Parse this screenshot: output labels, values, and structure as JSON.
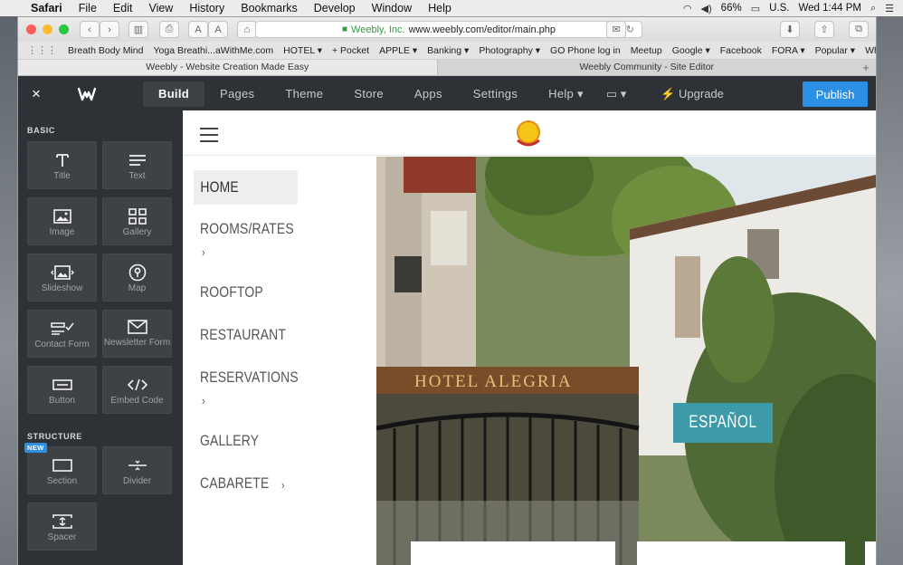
{
  "menubar": {
    "apple": "",
    "items": [
      "Safari",
      "File",
      "Edit",
      "View",
      "History",
      "Bookmarks",
      "Develop",
      "Window",
      "Help"
    ],
    "battery": "66%",
    "locale": "U.S.",
    "clock": "Wed 1:44 PM"
  },
  "browser": {
    "url_company": "Weebly, Inc.",
    "url": "www.weebly.com/editor/main.php",
    "bookmarks": [
      "Breath Body Mind",
      "Yoga Breathi...aWithMe.com",
      "HOTEL ▾",
      "+ Pocket",
      "APPLE ▾",
      "Banking ▾",
      "Photography ▾",
      "GO Phone log in",
      "Meetup",
      "Google ▾",
      "Facebook",
      "FORA ▾",
      "Popular ▾",
      "WhatsApp Web"
    ],
    "bookmarks_more": "»",
    "tabs": [
      "Weebly - Website Creation Made Easy",
      "Weebly Community - Site Editor"
    ],
    "tab_add": "+"
  },
  "editor": {
    "close": "×",
    "nav": [
      "Build",
      "Pages",
      "Theme",
      "Store",
      "Apps",
      "Settings",
      "Help ▾"
    ],
    "device": "▭ ▾",
    "upgrade": "⚡ Upgrade",
    "publish": "Publish"
  },
  "sidebar": {
    "basic_label": "BASIC",
    "structure_label": "STRUCTURE",
    "new_badge": "NEW",
    "tiles": {
      "title": "Title",
      "text": "Text",
      "image": "Image",
      "gallery": "Gallery",
      "slideshow": "Slideshow",
      "map": "Map",
      "contact_form": "Contact Form",
      "newsletter_form": "Newsletter Form",
      "button": "Button",
      "embed_code": "Embed Code",
      "section": "Section",
      "divider": "Divider",
      "spacer": "Spacer"
    }
  },
  "site": {
    "logo_text": "HOTEL ALEGRIA",
    "nav": {
      "home": "HOME",
      "rooms": "ROOMS/RATES",
      "rooftop": "ROOFTOP",
      "restaurant": "RESTAURANT",
      "reservations": "RESERVATIONS",
      "gallery": "GALLERY",
      "cabarete": "CABARETE"
    },
    "chevron": "›",
    "hero_sign": "HOTEL ALEGRIA",
    "espanol": "ESPAÑOL"
  },
  "colors": {
    "editor_bg": "#2e3135",
    "publish": "#2b8fe3",
    "espanol": "#3d9aa8"
  }
}
